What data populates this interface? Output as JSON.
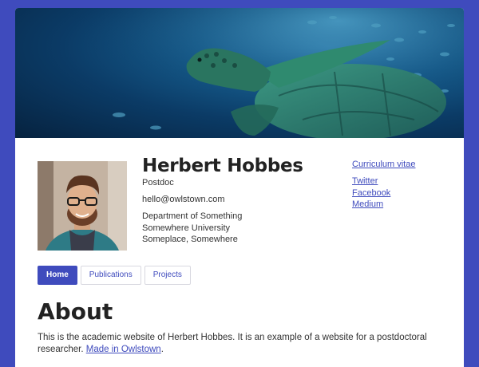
{
  "profile": {
    "name": "Herbert Hobbes",
    "role": "Postdoc",
    "email": "hello@owlstown.com",
    "affiliation": [
      "Department of Something",
      "Somewhere University",
      "Someplace, Somewhere"
    ]
  },
  "links": {
    "cv": "Curriculum vitae",
    "social": [
      "Twitter",
      "Facebook",
      "Medium"
    ]
  },
  "tabs": [
    {
      "label": "Home",
      "active": true
    },
    {
      "label": "Publications",
      "active": false
    },
    {
      "label": "Projects",
      "active": false
    }
  ],
  "about": {
    "title": "About",
    "text": "This is the academic website of Herbert Hobbes. It is an example of a website for a postdoctoral researcher.",
    "link_text": "Made in Owlstown",
    "after_link": "."
  },
  "colors": {
    "accent": "#3f4bbd",
    "frame": "#3f4bbd"
  },
  "icons": {
    "banner": "sea-turtle-underwater-image",
    "avatar": "profile-photo"
  }
}
